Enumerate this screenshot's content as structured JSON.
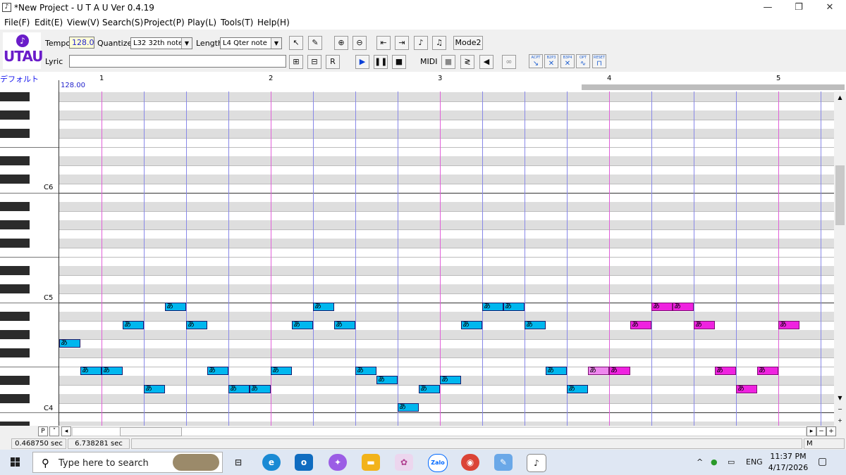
{
  "window": {
    "title": "*New Project - U T A U Ver 0.4.19",
    "minimize_icon": "—",
    "restore_icon": "❐",
    "close_icon": "✕"
  },
  "menu": [
    "File(F)",
    "Edit(E)",
    "View(V)",
    "Search(S)",
    "Project(P)",
    "Play(L)",
    "Tools(T)",
    "Help(H)"
  ],
  "logo": {
    "text": "UTAU"
  },
  "toolbar": {
    "tempo_label": "Tempo",
    "tempo_value": "128.0",
    "quantize_label": "Quantize",
    "quantize_value": "L32 32th note",
    "length_label": "Length",
    "length_value": "L4  Qter note",
    "lyric_label": "Lyric",
    "lyric_value": "",
    "mode_label": "Mode2",
    "midi_label": "MIDI",
    "fx_labels": [
      "ACPT",
      "B2P3",
      "B3P4",
      "OPT",
      "RESET"
    ]
  },
  "ruler": {
    "voice": "デフォルト",
    "tempo_marker": "128.00",
    "bars": [
      "1",
      "2",
      "3",
      "4",
      "5"
    ]
  },
  "keyboard": {
    "c_labels": [
      "C6",
      "C5",
      "C4"
    ]
  },
  "notes": [
    {
      "lyric": "あ",
      "pitch": "G4",
      "start": 0,
      "len": 1,
      "selected": false
    },
    {
      "lyric": "あ",
      "pitch": "E4",
      "start": 1,
      "len": 1,
      "selected": false
    },
    {
      "lyric": "あ",
      "pitch": "E4",
      "start": 2,
      "len": 1,
      "selected": false
    },
    {
      "lyric": "あ",
      "pitch": "A4",
      "start": 3,
      "len": 1,
      "selected": false
    },
    {
      "lyric": "あ",
      "pitch": "D4",
      "start": 4,
      "len": 1,
      "selected": false
    },
    {
      "lyric": "あ",
      "pitch": "B4",
      "start": 5,
      "len": 1,
      "selected": false
    },
    {
      "lyric": "あ",
      "pitch": "A4",
      "start": 6,
      "len": 1,
      "selected": false
    },
    {
      "lyric": "あ",
      "pitch": "E4",
      "start": 7,
      "len": 1,
      "selected": false
    },
    {
      "lyric": "あ",
      "pitch": "D4",
      "start": 8,
      "len": 1,
      "selected": false
    },
    {
      "lyric": "あ",
      "pitch": "D4",
      "start": 9,
      "len": 1,
      "selected": false
    },
    {
      "lyric": "あ",
      "pitch": "E4",
      "start": 10,
      "len": 1,
      "selected": false
    },
    {
      "lyric": "あ",
      "pitch": "A4",
      "start": 11,
      "len": 1,
      "selected": false
    },
    {
      "lyric": "あ",
      "pitch": "B4",
      "start": 12,
      "len": 1,
      "selected": false
    },
    {
      "lyric": "あ",
      "pitch": "A4",
      "start": 13,
      "len": 1,
      "selected": false
    },
    {
      "lyric": "あ",
      "pitch": "E4",
      "start": 14,
      "len": 1,
      "selected": false
    },
    {
      "lyric": "あ",
      "pitch": "D#4",
      "start": 15,
      "len": 1,
      "selected": false
    },
    {
      "lyric": "あ",
      "pitch": "C4",
      "start": 16,
      "len": 1,
      "selected": false
    },
    {
      "lyric": "あ",
      "pitch": "D4",
      "start": 17,
      "len": 1,
      "selected": false
    },
    {
      "lyric": "あ",
      "pitch": "D#4",
      "start": 18,
      "len": 1,
      "selected": false
    },
    {
      "lyric": "あ",
      "pitch": "A4",
      "start": 19,
      "len": 1,
      "selected": false
    },
    {
      "lyric": "あ",
      "pitch": "B4",
      "start": 20,
      "len": 1,
      "selected": false
    },
    {
      "lyric": "あ",
      "pitch": "B4",
      "start": 21,
      "len": 1,
      "selected": false
    },
    {
      "lyric": "あ",
      "pitch": "A4",
      "start": 22,
      "len": 1,
      "selected": false
    },
    {
      "lyric": "あ",
      "pitch": "E4",
      "start": 23,
      "len": 1,
      "selected": false
    },
    {
      "lyric": "あ",
      "pitch": "D4",
      "start": 24,
      "len": 1,
      "selected": false
    },
    {
      "lyric": "あ",
      "pitch": "E4",
      "start": 25,
      "len": 1,
      "selected": true
    },
    {
      "lyric": "あ",
      "pitch": "E4",
      "start": 26,
      "len": 1,
      "selected": true
    },
    {
      "lyric": "あ",
      "pitch": "A4",
      "start": 27,
      "len": 1,
      "selected": true
    },
    {
      "lyric": "あ",
      "pitch": "B4",
      "start": 28,
      "len": 1,
      "selected": true
    },
    {
      "lyric": "あ",
      "pitch": "B4",
      "start": 29,
      "len": 1,
      "selected": true
    },
    {
      "lyric": "あ",
      "pitch": "A4",
      "start": 30,
      "len": 1,
      "selected": true
    },
    {
      "lyric": "あ",
      "pitch": "E4",
      "start": 31,
      "len": 1,
      "selected": true
    },
    {
      "lyric": "あ",
      "pitch": "D4",
      "start": 32,
      "len": 1,
      "selected": true
    },
    {
      "lyric": "あ",
      "pitch": "E4",
      "start": 33,
      "len": 1,
      "selected": true
    },
    {
      "lyric": "あ",
      "pitch": "A4",
      "start": 34,
      "len": 1,
      "selected": true
    }
  ],
  "status": {
    "left_time": "0.468750 sec",
    "right_time": "6.738281 sec",
    "right_cell": "M",
    "part_label": "P"
  },
  "taskbar": {
    "search_placeholder": "Type here to search",
    "language": "ENG",
    "time": "11:37 PM",
    "date": "4/17/2026",
    "apps": [
      "task-view-icon",
      "edge-icon",
      "outlook-icon",
      "copilot-icon",
      "explorer-icon",
      "app-icon",
      "zalo-icon",
      "chrome-icon",
      "paint-icon",
      "utau-icon"
    ]
  },
  "colors": {
    "note_normal": "#00b7ef",
    "note_selected": "#ef22e0",
    "note_selected_light": "#ee86ee",
    "bar_line": "#e060d8",
    "beat_line": "#8888e8"
  }
}
